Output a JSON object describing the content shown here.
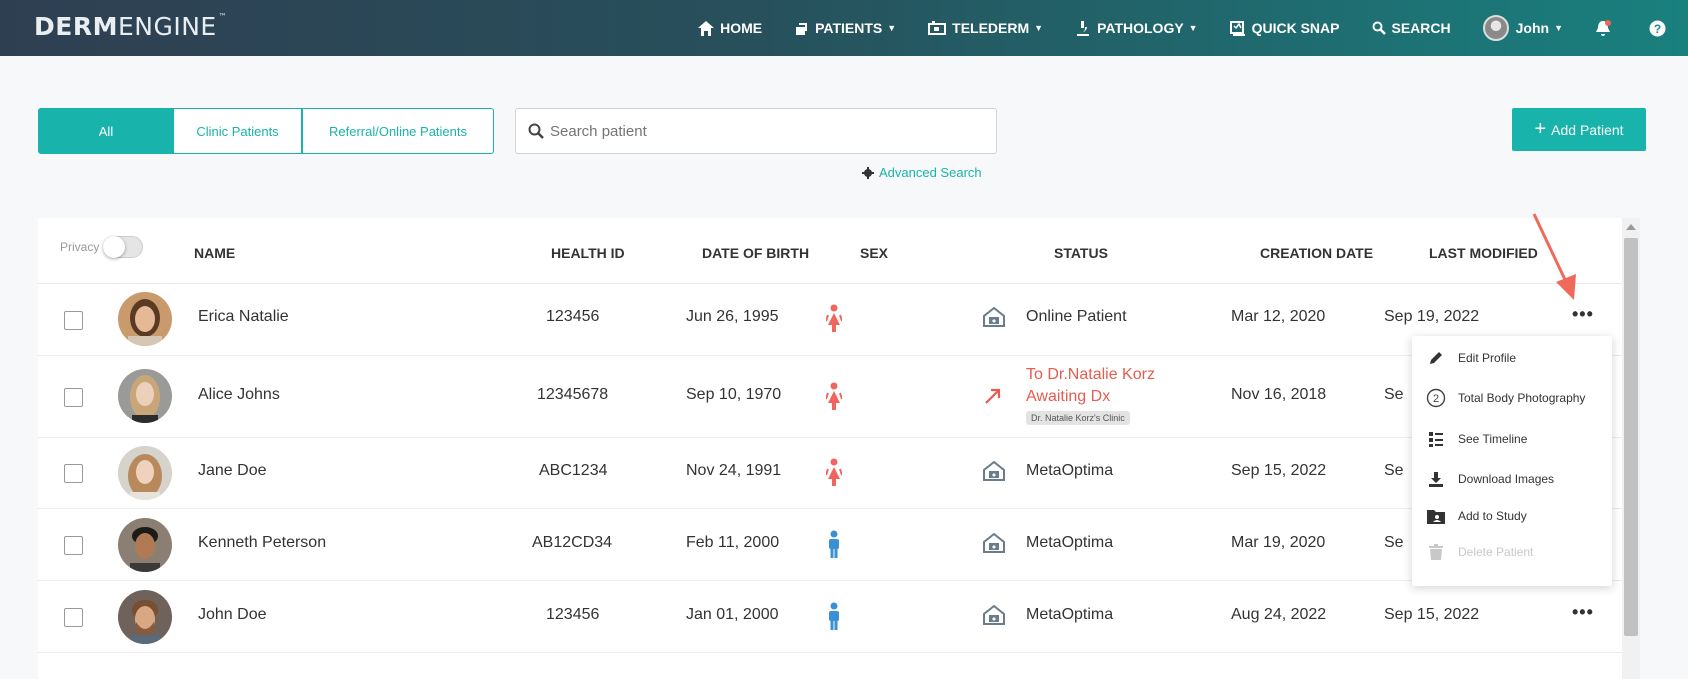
{
  "nav": {
    "logo_bold": "DERM",
    "logo_light": "ENGINE",
    "logo_tm": "™",
    "items": [
      {
        "label": "HOME",
        "icon": "home-icon",
        "caret": false
      },
      {
        "label": "PATIENTS",
        "icon": "patients-icon",
        "caret": true
      },
      {
        "label": "TELEDERM",
        "icon": "telederm-icon",
        "caret": true
      },
      {
        "label": "PATHOLOGY",
        "icon": "microscope-icon",
        "caret": true
      },
      {
        "label": "QUICK SNAP",
        "icon": "quick-snap-icon",
        "caret": false
      },
      {
        "label": "SEARCH",
        "icon": "search-icon",
        "caret": false
      }
    ],
    "user_name": "John"
  },
  "filters": {
    "all": "All",
    "clinic": "Clinic Patients",
    "referral": "Referral/Online Patients"
  },
  "search": {
    "placeholder": "Search patient",
    "advanced": "Advanced Search"
  },
  "add_patient": "Add Patient",
  "table": {
    "privacy_label": "Privacy",
    "headers": {
      "name": "NAME",
      "health_id": "HEALTH ID",
      "dob": "DATE OF BIRTH",
      "sex": "SEX",
      "status": "STATUS",
      "created": "CREATION DATE",
      "modified": "LAST MODIFIED"
    },
    "rows": [
      {
        "name": "Erica Natalie",
        "health_id": "123456",
        "dob": "Jun 26, 1995",
        "sex": "female",
        "status": "Online Patient",
        "created": "Mar 12, 2020",
        "modified": "Sep 19, 2022"
      },
      {
        "name": "Alice Johns",
        "health_id": "12345678",
        "dob": "Sep 10, 1970",
        "sex": "female",
        "status_line1": "To Dr.Natalie Korz",
        "status_line2": "Awaiting Dx",
        "clinic_tag": "Dr. Natalie Korz's Clinic",
        "created": "Nov 16, 2018",
        "modified": "Se"
      },
      {
        "name": "Jane Doe",
        "health_id": "ABC1234",
        "dob": "Nov 24, 1991",
        "sex": "female",
        "status": "MetaOptima",
        "created": "Sep 15, 2022",
        "modified": "Se"
      },
      {
        "name": "Kenneth Peterson",
        "health_id": "AB12CD34",
        "dob": "Feb 11, 2000",
        "sex": "male",
        "status": "MetaOptima",
        "created": "Mar 19, 2020",
        "modified": "Se"
      },
      {
        "name": "John Doe",
        "health_id": "123456",
        "dob": "Jan 01, 2000",
        "sex": "male",
        "status": "MetaOptima",
        "created": "Aug 24, 2022",
        "modified": "Sep 15, 2022"
      }
    ]
  },
  "menu": {
    "items": [
      {
        "label": "Edit Profile",
        "icon": "pencil-icon",
        "disabled": false
      },
      {
        "label": "Total Body Photography",
        "icon": "total-body-icon",
        "badge": "2",
        "disabled": false
      },
      {
        "label": "See Timeline",
        "icon": "timeline-icon",
        "disabled": false
      },
      {
        "label": "Download Images",
        "icon": "download-icon",
        "disabled": false
      },
      {
        "label": "Add to Study",
        "icon": "study-folder-icon",
        "disabled": false
      },
      {
        "label": "Delete Patient",
        "icon": "trash-icon",
        "disabled": true
      }
    ]
  },
  "colors": {
    "accent": "#18b3aa",
    "female": "#f0665e",
    "male": "#3b8fd4",
    "referral": "#e65c4f",
    "annotation_arrow": "#ef6a5b"
  }
}
